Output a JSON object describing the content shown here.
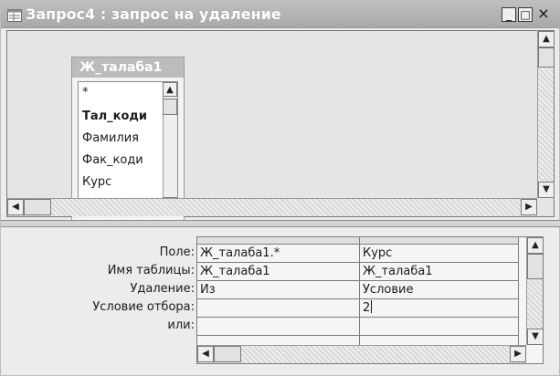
{
  "window": {
    "title": "Запрос4 : запрос на удаление",
    "controls": {
      "minimize": "_",
      "maximize": "□",
      "close": "×"
    }
  },
  "table": {
    "name": "Ж_талаба1",
    "fields": [
      "*",
      "Тал_коди",
      "Фамилия",
      "Фак_коди",
      "Курс"
    ]
  },
  "grid": {
    "row_labels": [
      "Поле:",
      "Имя таблицы:",
      "Удаление:",
      "Условие отбора:",
      "или:"
    ],
    "columns": [
      {
        "field": "Ж_талаба1.*",
        "table": "Ж_талаба1",
        "delete": "Из",
        "criteria": "",
        "or": ""
      },
      {
        "field": "Курс",
        "table": "Ж_талаба1",
        "delete": "Условие",
        "criteria": "2",
        "or": ""
      }
    ]
  },
  "icons": {
    "title": "query-icon",
    "scroll_up": "arrow-up-icon",
    "scroll_down": "arrow-down-icon",
    "scroll_left": "arrow-left-icon",
    "scroll_right": "arrow-right-icon"
  }
}
